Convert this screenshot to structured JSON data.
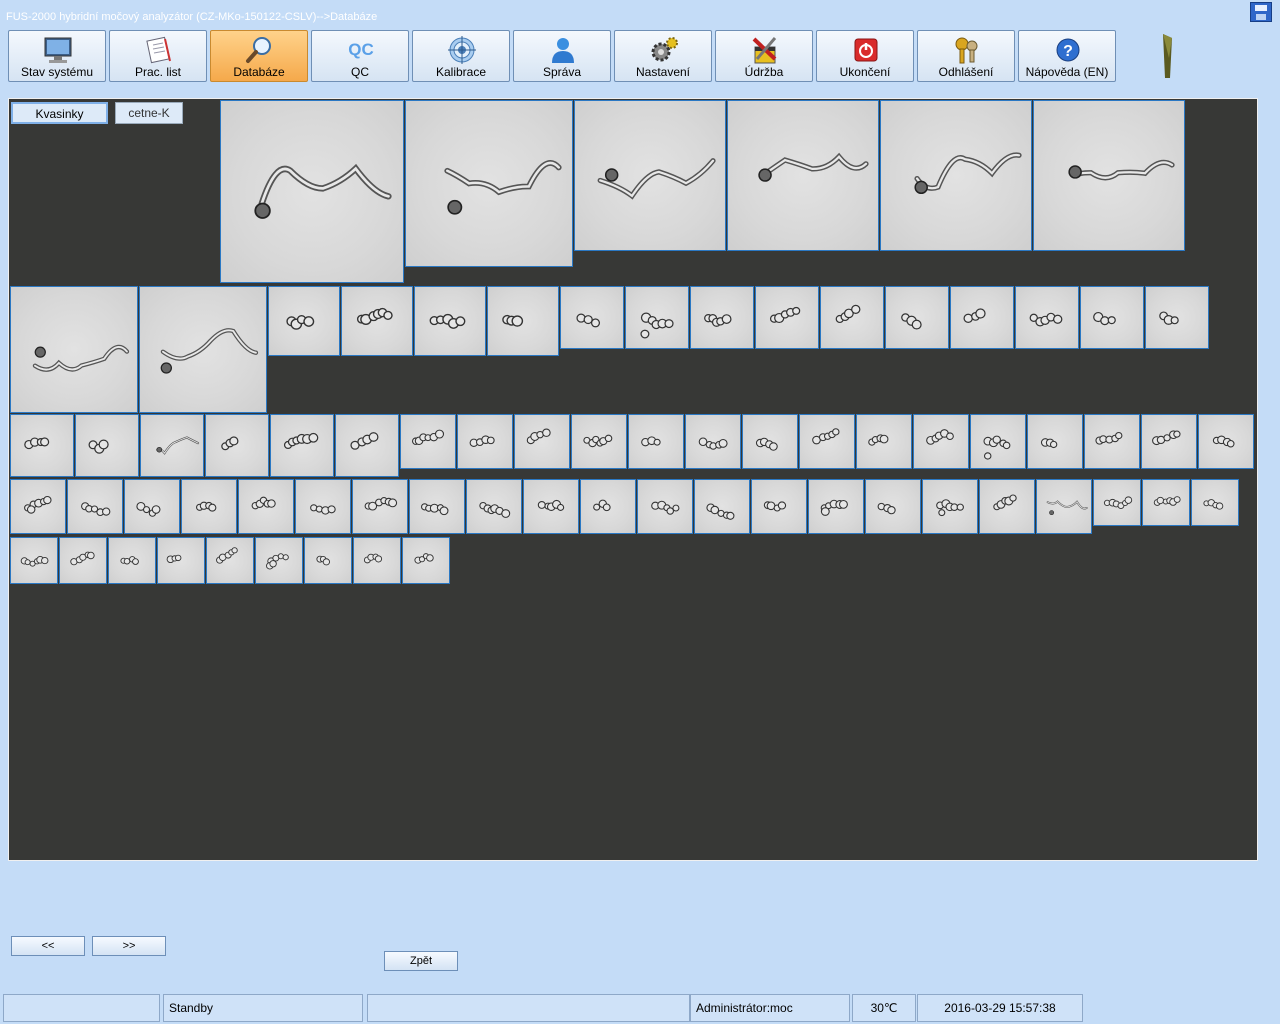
{
  "window": {
    "title": "FUS-2000 hybridní močový analyzátor (CZ-MKo-150122-CSLV)-->Databáze",
    "save_icon": "save-icon"
  },
  "toolbar": {
    "active_color": "#f5a94b",
    "buttons": [
      {
        "label": "Stav systému",
        "icon": "monitor-icon"
      },
      {
        "label": "Prac. list",
        "icon": "worklist-icon"
      },
      {
        "label": "Databáze",
        "icon": "magnifier-icon"
      },
      {
        "label": "QC",
        "icon": "qc-icon"
      },
      {
        "label": "Kalibrace",
        "icon": "target-icon"
      },
      {
        "label": "Správa",
        "icon": "user-icon"
      },
      {
        "label": "Nastavení",
        "icon": "gears-icon"
      },
      {
        "label": "Údržba",
        "icon": "tools-icon"
      },
      {
        "label": "Ukončení",
        "icon": "power-icon"
      },
      {
        "label": "Odhlášení",
        "icon": "keys-icon"
      },
      {
        "label": "Nápověda (EN)",
        "icon": "help-icon"
      }
    ],
    "qc_icon_text": "QC",
    "help_icon_text": "?"
  },
  "tabs": {
    "selected": "Kvasinky",
    "other": "cetne-K"
  },
  "nav": {
    "prev": "<<",
    "next": ">>",
    "back": "Zpět"
  },
  "status": {
    "cell1": "",
    "state": "Standby",
    "cell3": "",
    "user": "Administrátor:moc",
    "temperature": "30℃",
    "datetime": "2016-03-29 15:57:38"
  }
}
